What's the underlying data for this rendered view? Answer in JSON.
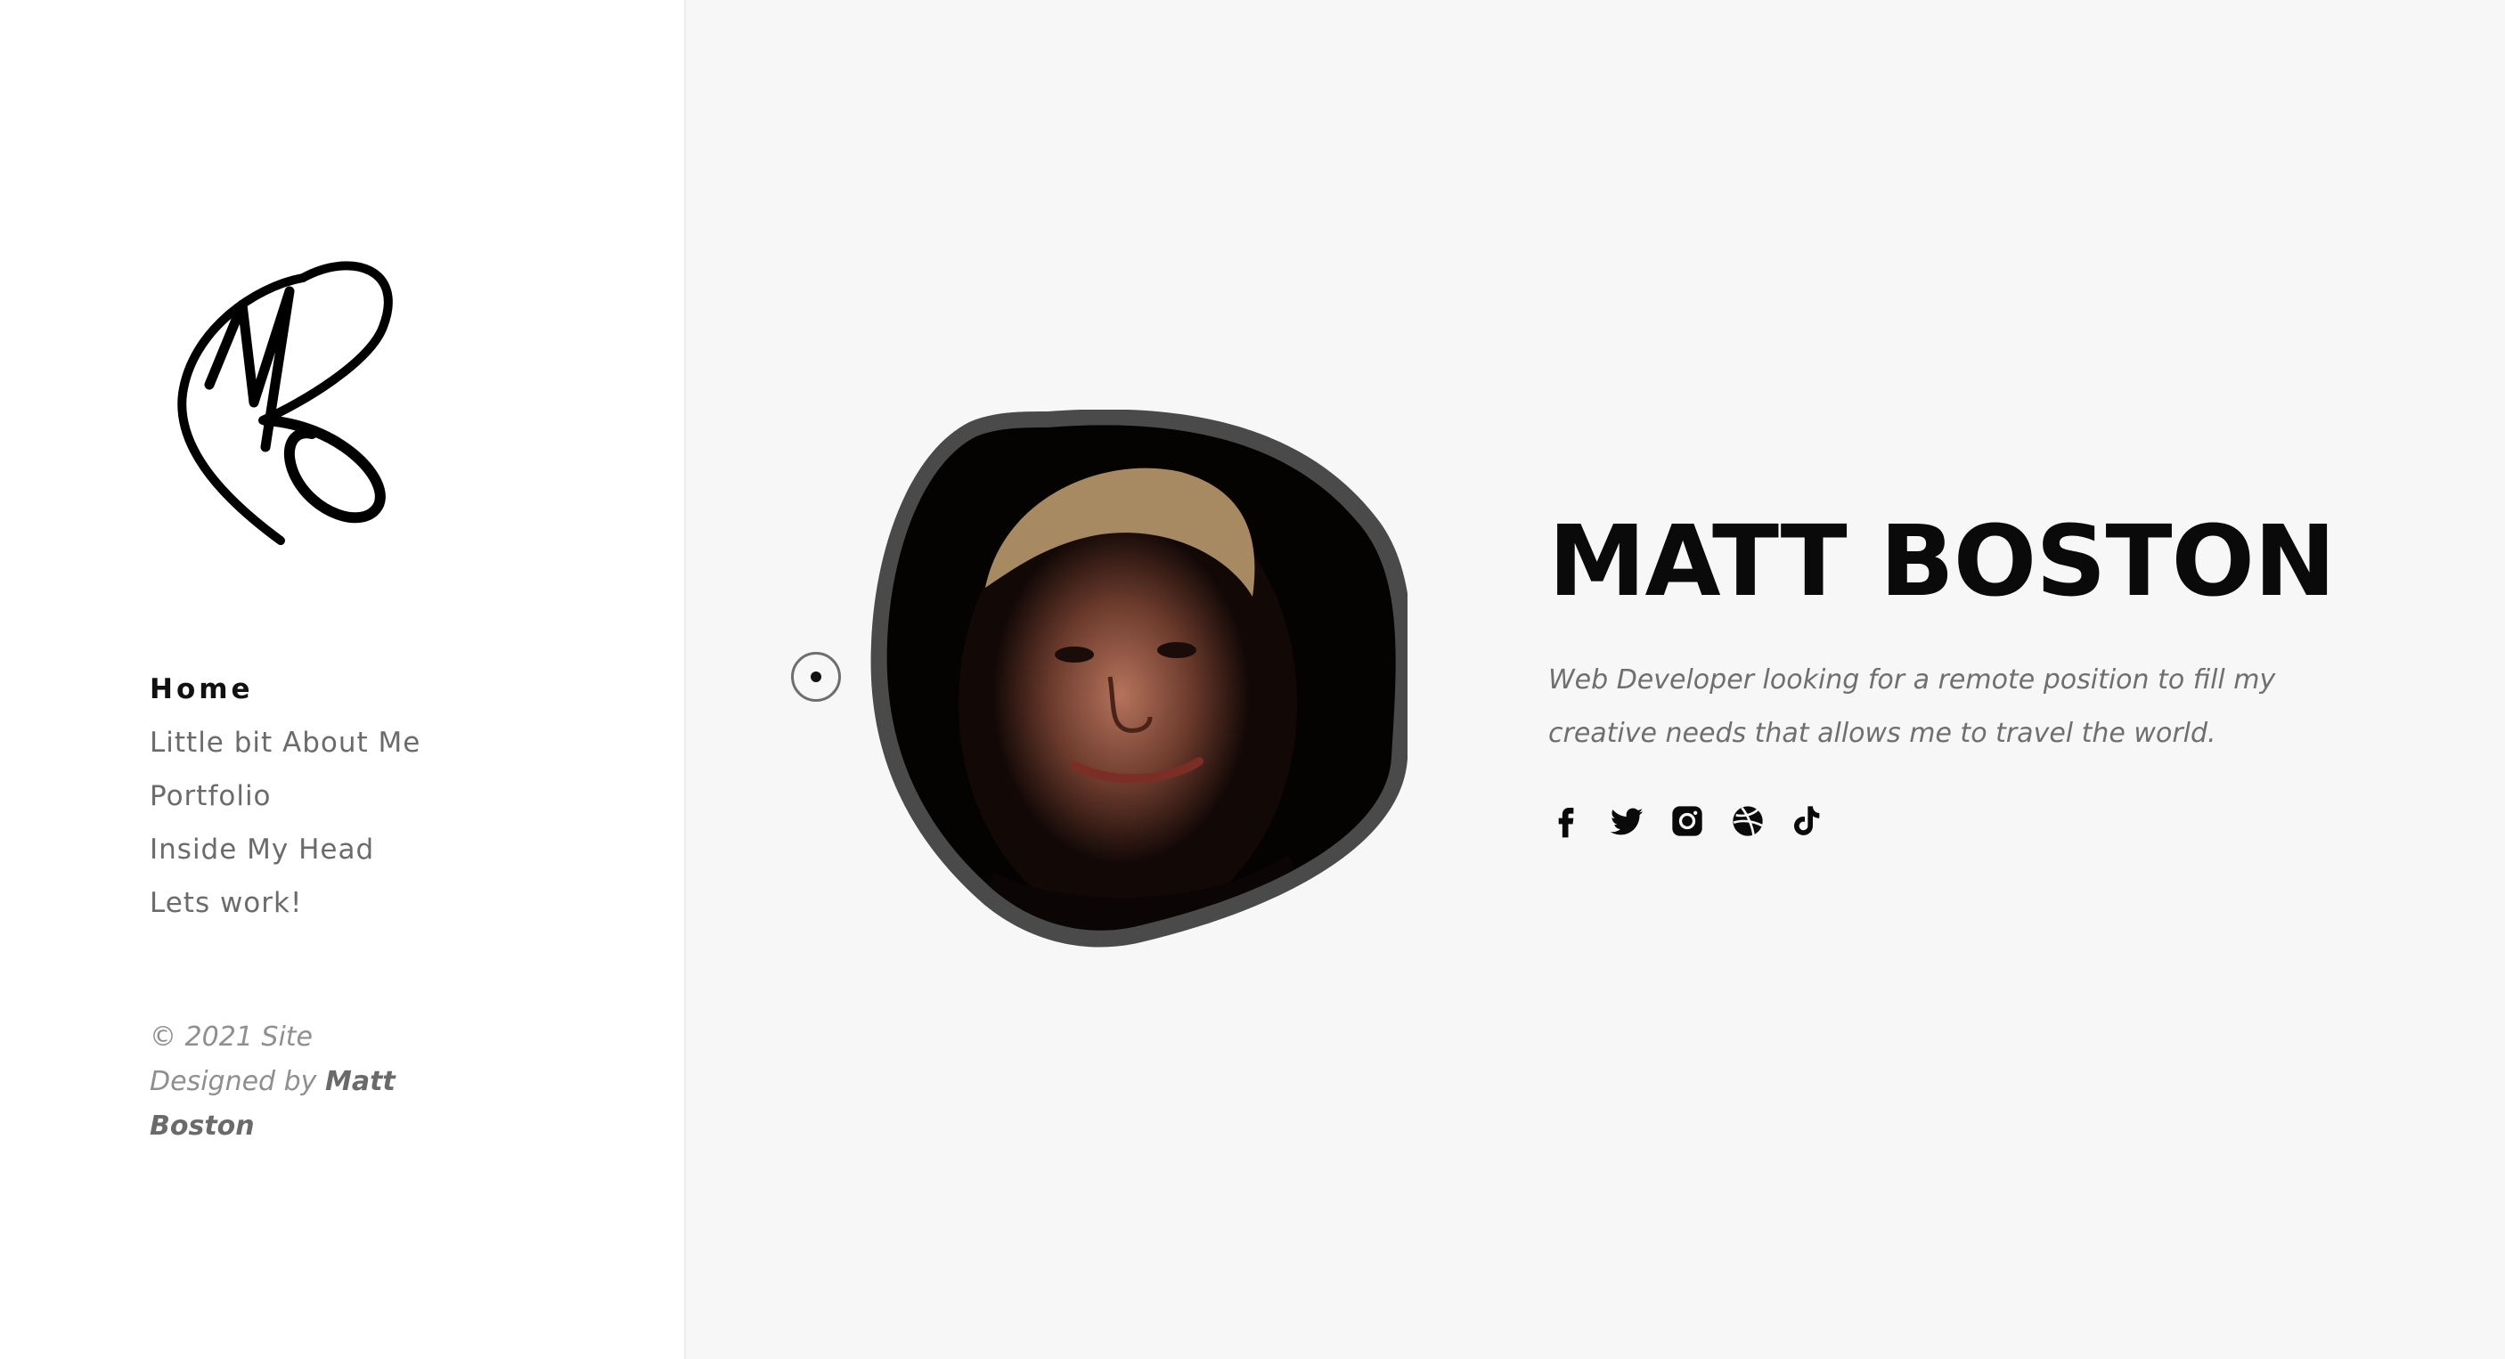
{
  "sidebar": {
    "logo_icon": "mb-signature-logo-icon",
    "nav": [
      {
        "label": "Home",
        "active": true
      },
      {
        "label": "Little bit About Me",
        "active": false
      },
      {
        "label": "Portfolio",
        "active": false
      },
      {
        "label": "Inside My Head",
        "active": false
      },
      {
        "label": "Lets work!",
        "active": false
      }
    ],
    "footer": {
      "line1": "© 2021 Site",
      "designed_by": "Designed by",
      "author": "Matt Boston"
    }
  },
  "hero": {
    "name": "MATT BOSTON",
    "tagline": "Web Developer looking for a remote position to fill my creative needs that allows me to travel the world.",
    "socials": [
      {
        "icon": "facebook-icon"
      },
      {
        "icon": "twitter-icon"
      },
      {
        "icon": "instagram-icon"
      },
      {
        "icon": "dribbble-icon"
      },
      {
        "icon": "tiktok-icon"
      }
    ]
  },
  "colors": {
    "sidebar_bg": "#ffffff",
    "main_bg": "#f7f7f7",
    "text_dark": "#0a0a0a",
    "text_muted": "#6f6f6f",
    "portrait_border": "#4a4a4a"
  }
}
